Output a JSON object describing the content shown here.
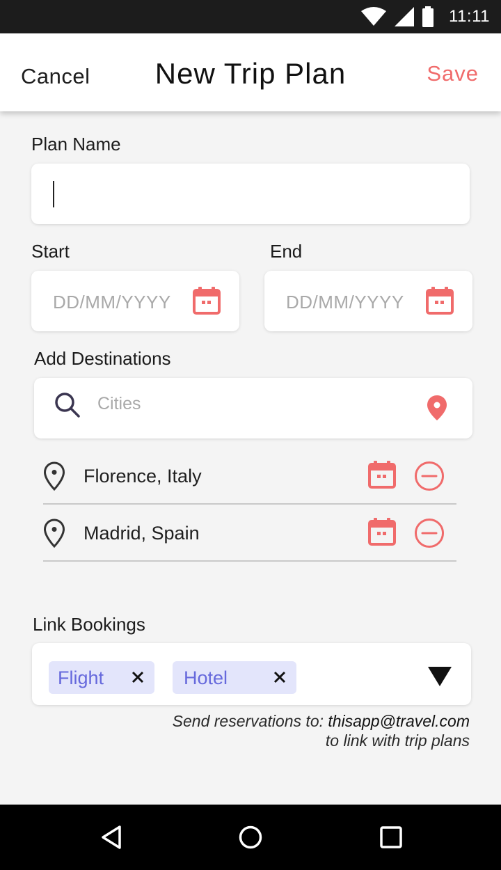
{
  "status_bar": {
    "time": "11:11",
    "icons": [
      "wifi-icon",
      "signal-icon",
      "battery-icon"
    ]
  },
  "app_bar": {
    "cancel_label": "Cancel",
    "title": "New Trip Plan",
    "save_label": "Save"
  },
  "form": {
    "plan_name_label": "Plan Name",
    "plan_name_value": "",
    "start_label": "Start",
    "start_placeholder": "DD/MM/YYYY",
    "end_label": "End",
    "end_placeholder": "DD/MM/YYYY",
    "destinations_label": "Add Destinations",
    "destinations_placeholder": "Cities",
    "destinations": [
      {
        "name": "Florence, Italy"
      },
      {
        "name": "Madrid, Spain"
      }
    ],
    "bookings_label": "Link Bookings",
    "booking_chips": [
      {
        "label": "Flight"
      },
      {
        "label": "Hotel"
      }
    ],
    "note_line1_prefix": "Send reservations to: ",
    "note_email": "thisapp@travel.com",
    "note_line2": "to link with trip plans"
  },
  "nav_bar": {
    "buttons": [
      "back-icon",
      "home-icon",
      "recents-icon"
    ]
  },
  "colors": {
    "accent": "#f06b6b",
    "chip_bg": "#e3e5fb",
    "chip_text": "#6669dc",
    "search_icon": "#3a3550"
  }
}
